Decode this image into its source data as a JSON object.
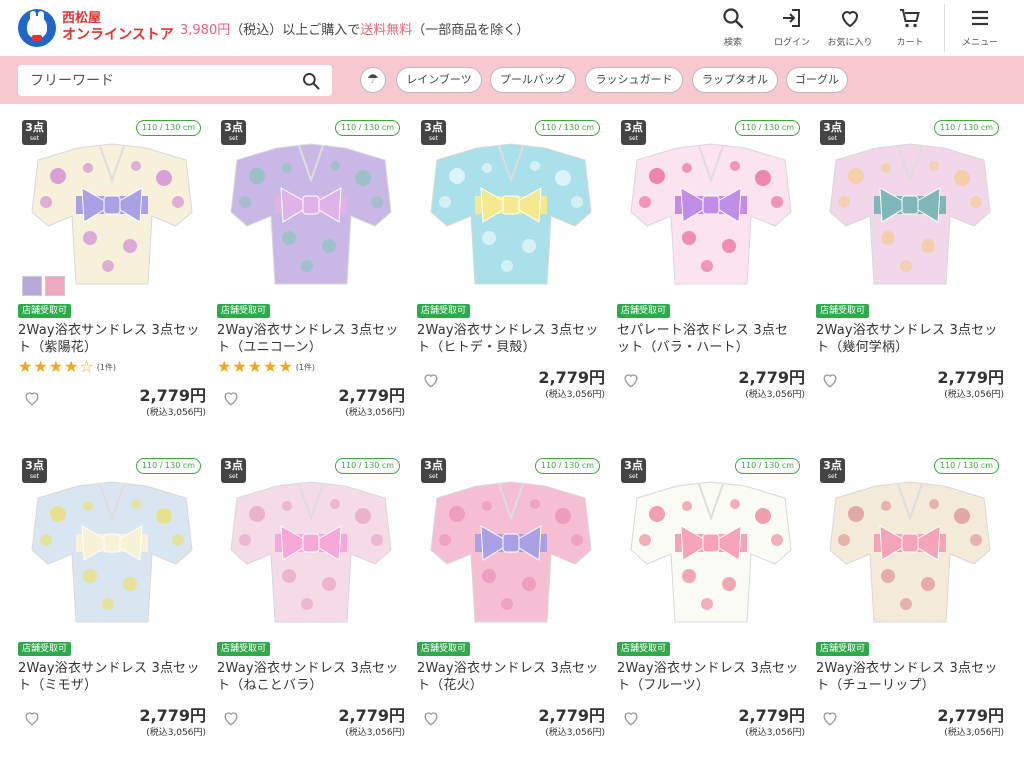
{
  "header": {
    "logo_line1": "西松屋",
    "logo_line2": "オンラインストア",
    "promo_price": "3,980円",
    "promo_mid": "（税込）以上ご購入で",
    "promo_free": "送料無料",
    "promo_end": "（一部商品を除く）",
    "nav": [
      {
        "label": "検索",
        "icon": "search-icon"
      },
      {
        "label": "ログイン",
        "icon": "login-icon"
      },
      {
        "label": "お気に入り",
        "icon": "heart-icon"
      },
      {
        "label": "カート",
        "icon": "cart-icon"
      },
      {
        "label": "メニュー",
        "icon": "menu-icon"
      }
    ]
  },
  "search": {
    "placeholder": "フリーワード",
    "chips": [
      "レインブーツ",
      "プールバッグ",
      "ラッシュガード",
      "ラップタオル",
      "ゴーグル"
    ],
    "umbrella_glyph": "☂"
  },
  "badges": {
    "set_num": "3点",
    "set_word": "set",
    "size": "110 / 130 cm",
    "store": "店舗受取可"
  },
  "products": [
    {
      "line1": "2Way浴衣サンドレス 3点セッ",
      "line2": "ト（紫陽花）",
      "rating": 4,
      "rating_count": "(1件)",
      "price": "2,779円",
      "tax": "(税込3,056円)",
      "colors": {
        "bg": "#f7f1dc",
        "pattern": "#c66bd0",
        "obi": "#a9a0e6"
      }
    },
    {
      "line1": "2Way浴衣サンドレス 3点セッ",
      "line2": "ト（ユニコーン）",
      "rating": 5,
      "rating_count": "(1件)",
      "price": "2,779円",
      "tax": "(税込3,056円)",
      "colors": {
        "bg": "#c9b8e6",
        "pattern": "#7dc6b0",
        "obi": "#e0b3e8"
      }
    },
    {
      "line1": "2Way浴衣サンドレス 3点セッ",
      "line2": "ト（ヒトデ・貝殻）",
      "rating": null,
      "rating_count": "",
      "price": "2,779円",
      "tax": "(税込3,056円)",
      "colors": {
        "bg": "#a9e0ea",
        "pattern": "#ffffff",
        "obi": "#f5e98f"
      }
    },
    {
      "line1": "セパレート浴衣ドレス 3点セ",
      "line2": "ット（バラ・ハート）",
      "rating": null,
      "rating_count": "",
      "price": "2,779円",
      "tax": "(税込3,056円)",
      "colors": {
        "bg": "#fbe3ef",
        "pattern": "#e8497e",
        "obi": "#c08ee6"
      }
    },
    {
      "line1": "2Way浴衣サンドレス 3点セッ",
      "line2": "ト（幾何学柄）",
      "rating": null,
      "rating_count": "",
      "price": "2,779円",
      "tax": "(税込3,056円)",
      "colors": {
        "bg": "#f2d6e9",
        "pattern": "#f3c97d",
        "obi": "#7fb6b8"
      }
    },
    {
      "line1": "2Way浴衣サンドレス 3点セッ",
      "line2": "ト（ミモザ）",
      "rating": null,
      "rating_count": "",
      "price": "2,779円",
      "tax": "(税込3,056円)",
      "colors": {
        "bg": "#d9e6f2",
        "pattern": "#f0dd4a",
        "obi": "#f7f1d6"
      }
    },
    {
      "line1": "2Way浴衣サンドレス 3点セッ",
      "line2": "ト（ねことバラ）",
      "rating": null,
      "rating_count": "",
      "price": "2,779円",
      "tax": "(税込3,056円)",
      "colors": {
        "bg": "#f5dbe6",
        "pattern": "#e496b8",
        "obi": "#f6a8d8"
      }
    },
    {
      "line1": "2Way浴衣サンドレス 3点セッ",
      "line2": "ト（花火）",
      "rating": null,
      "rating_count": "",
      "price": "2,779円",
      "tax": "(税込3,056円)",
      "colors": {
        "bg": "#f6bed3",
        "pattern": "#e987b0",
        "obi": "#a9a0e6"
      }
    },
    {
      "line1": "2Way浴衣サンドレス 3点セッ",
      "line2": "ト（フルーツ）",
      "rating": null,
      "rating_count": "",
      "price": "2,779円",
      "tax": "(税込3,056円)",
      "colors": {
        "bg": "#fbfbf5",
        "pattern": "#e9637e",
        "obi": "#f4a3b8"
      }
    },
    {
      "line1": "2Way浴衣サンドレス 3点セッ",
      "line2": "ト（チューリップ）",
      "rating": null,
      "rating_count": "",
      "price": "2,779円",
      "tax": "(税込3,056円)",
      "colors": {
        "bg": "#f3ead9",
        "pattern": "#d77a86",
        "obi": "#f4a3b8"
      }
    }
  ]
}
